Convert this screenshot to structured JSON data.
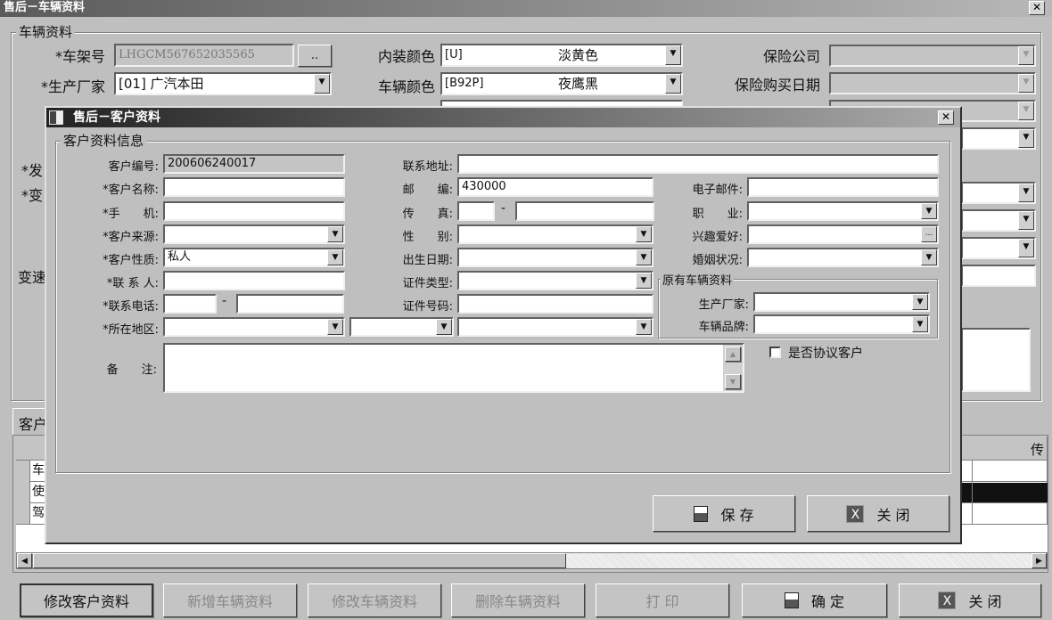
{
  "main": {
    "title": "售后－车辆资料",
    "group": "车辆资料",
    "vin_label": "*车架号",
    "vin": "LHGCM567652035565",
    "vin_btn": "..",
    "maker_label": "*生产厂家",
    "maker": "[01] 广汽本田",
    "inner_color_label": "内装颜色",
    "inner_code": "[U]",
    "inner_color": "淡黄色",
    "car_color_label": "车辆颜色",
    "car_code": "[B92P]",
    "car_color": "夜鹰黑",
    "ins_company_label": "保险公司",
    "ins_date_label": "保险购买日期",
    "left_partial": [
      "*发",
      "*变",
      "变速"
    ],
    "tab": "客户",
    "grid_header_right": "传",
    "grid_rows": [
      "车",
      "使",
      "驾"
    ],
    "buttons": [
      "修改客户资料",
      "新增车辆资料",
      "修改车辆资料",
      "删除车辆资料",
      "打 印",
      "确 定",
      "关 闭"
    ]
  },
  "dialog": {
    "title": "售后－客户资料",
    "group": "客户资料信息",
    "col1": [
      {
        "label": "客户编号:",
        "value": "200606240017"
      },
      {
        "label": "*客户名称:",
        "value": ""
      },
      {
        "label": "*手　　机:",
        "value": ""
      },
      {
        "label": "*客户来源:",
        "value": ""
      },
      {
        "label": "*客户性质:",
        "value": "私人"
      },
      {
        "label": "*联 系 人:",
        "value": ""
      },
      {
        "label": "*联系电话:",
        "value": ""
      },
      {
        "label": "*所在地区:",
        "value": ""
      }
    ],
    "col2": [
      {
        "label": "联系地址:",
        "value": ""
      },
      {
        "label": "邮　　编:",
        "value": "430000"
      },
      {
        "label": "传　　真:",
        "value": ""
      },
      {
        "label": "性　　别:",
        "value": ""
      },
      {
        "label": "出生日期:",
        "value": ""
      },
      {
        "label": "证件类型:",
        "value": ""
      },
      {
        "label": "证件号码:",
        "value": ""
      }
    ],
    "col3": [
      {
        "label": "电子邮件:",
        "value": ""
      },
      {
        "label": "职　　业:",
        "value": ""
      },
      {
        "label": "兴趣爱好:",
        "value": ""
      },
      {
        "label": "婚姻状况:",
        "value": ""
      }
    ],
    "old_group": "原有车辆资料",
    "old_maker": "生产厂家:",
    "old_brand": "车辆品牌:",
    "remark_label": "备　　注:",
    "agreement": "是否协议客户",
    "hobby_btn": "...",
    "save": "保 存",
    "close": "关 闭"
  }
}
